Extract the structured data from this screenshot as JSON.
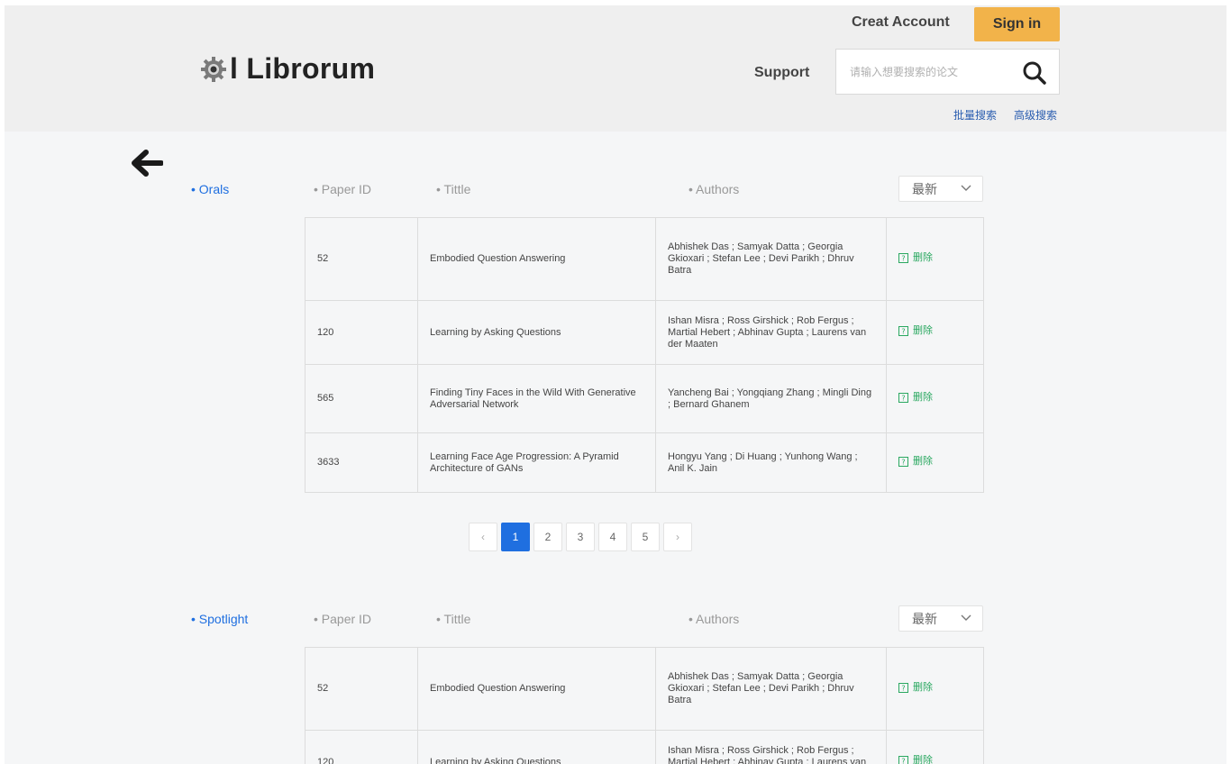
{
  "header": {
    "logo_text": "l Librorum",
    "creat_account": "Creat Account",
    "sign_in": "Sign in",
    "support": "Support",
    "search_placeholder": "请输入想要搜索的论文",
    "batch_search": "批量搜索",
    "advanced_search": "高级搜索"
  },
  "columns": {
    "paper_id": "Paper ID",
    "title": "Tittle",
    "authors": "Authors"
  },
  "sort_option": "最新",
  "delete_label": "删除",
  "sections": [
    {
      "label": "Orals",
      "rows": [
        {
          "id": "52",
          "title": "Embodied Question Answering",
          "authors": "Abhishek Das ; Samyak Datta ; Georgia Gkioxari ; Stefan Lee ; Devi Parikh ; Dhruv Batra"
        },
        {
          "id": "120",
          "title": "Learning by Asking Questions",
          "authors": "Ishan Misra ; Ross Girshick ; Rob Fergus ; Martial Hebert ; Abhinav Gupta ; Laurens van der Maaten"
        },
        {
          "id": "565",
          "title": "Finding Tiny Faces in the Wild With Generative Adversarial Network",
          "authors": "Yancheng Bai ; Yongqiang Zhang ; Mingli Ding ; Bernard Ghanem"
        },
        {
          "id": "3633",
          "title": "Learning Face Age Progression: A Pyramid Architecture of GANs",
          "authors": "Hongyu Yang ; Di Huang ; Yunhong Wang ; Anil K. Jain"
        }
      ]
    },
    {
      "label": "Spotlight",
      "rows": [
        {
          "id": "52",
          "title": "Embodied Question Answering",
          "authors": "Abhishek Das ; Samyak Datta ; Georgia Gkioxari ; Stefan Lee ; Devi Parikh ; Dhruv Batra"
        },
        {
          "id": "120",
          "title": "Learning by Asking Questions",
          "authors": "Ishan Misra ; Ross Girshick ; Rob Fergus ; Martial Hebert ; Abhinav Gupta ; Laurens van der Maaten"
        }
      ]
    }
  ],
  "pagination": {
    "prev": "‹",
    "pages": [
      "1",
      "2",
      "3",
      "4",
      "5"
    ],
    "current": "1",
    "next": "›"
  },
  "colors": {
    "accent_blue": "#1f6fe0",
    "sign_in_bg": "#f2b34a",
    "delete_green": "#2aa860"
  },
  "icons": [
    "gear-logo-icon",
    "search-icon",
    "back-arrow-icon",
    "chevron-down-icon",
    "delete-icon"
  ]
}
